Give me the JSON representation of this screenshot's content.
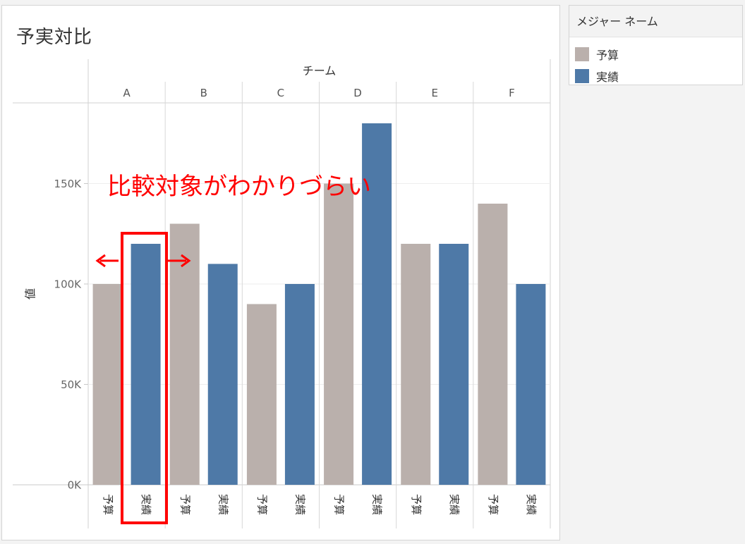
{
  "title": "予実対比",
  "legend": {
    "title": "メジャー ネーム",
    "items": [
      {
        "label": "予算",
        "color": "#bab0ac"
      },
      {
        "label": "実績",
        "color": "#4e79a7"
      }
    ]
  },
  "annotation": {
    "text": "比較対象がわかりづらい",
    "color": "#ff0000"
  },
  "chart_data": {
    "type": "bar",
    "column_header": "チーム",
    "categories": [
      "A",
      "B",
      "C",
      "D",
      "E",
      "F"
    ],
    "subcategories": [
      "予算",
      "実績"
    ],
    "series": [
      {
        "name": "予算",
        "color": "#bab0ac",
        "values": [
          100000,
          130000,
          90000,
          150000,
          120000,
          140000
        ]
      },
      {
        "name": "実績",
        "color": "#4e79a7",
        "values": [
          120000,
          110000,
          100000,
          180000,
          120000,
          100000
        ]
      }
    ],
    "ylabel": "値",
    "ylim": [
      0,
      190000
    ],
    "yticks": [
      {
        "value": 0,
        "label": "0K"
      },
      {
        "value": 50000,
        "label": "50K"
      },
      {
        "value": 100000,
        "label": "100K"
      },
      {
        "value": 150000,
        "label": "150K"
      }
    ],
    "grid": true
  }
}
